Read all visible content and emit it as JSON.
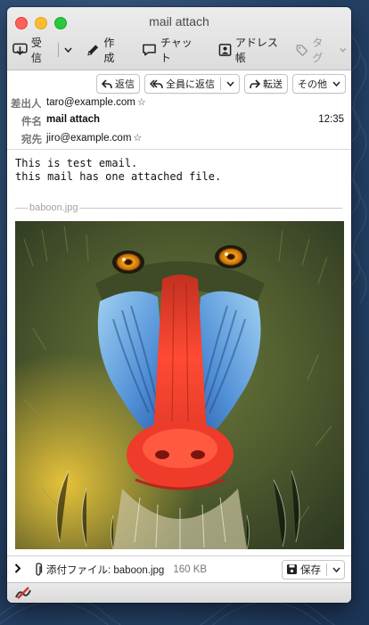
{
  "window": {
    "title": "mail attach"
  },
  "toolbar": {
    "receive_label": "受信",
    "compose_label": "作成",
    "chat_label": "チャット",
    "addressbook_label": "アドレス帳",
    "tag_label": "タグ"
  },
  "actions": {
    "reply_label": "返信",
    "reply_all_label": "全員に返信",
    "forward_label": "転送",
    "other_label": "その他"
  },
  "headers": {
    "from_label": "差出人",
    "from_value": "taro@example.com",
    "subject_label": "件名",
    "subject_value": "mail attach",
    "time": "12:35",
    "to_label": "宛先",
    "to_value": "jiro@example.com"
  },
  "body": {
    "line1": "This is test email.",
    "line2": "this mail has one attached file."
  },
  "attachment": {
    "separator_name": "baboon.jpg",
    "footer_label": "添付ファイル: baboon.jpg",
    "size": "160 KB",
    "save_label": "保存"
  },
  "colors": {
    "accent_red": "#d0312d",
    "window_bg": "#ffffff"
  }
}
